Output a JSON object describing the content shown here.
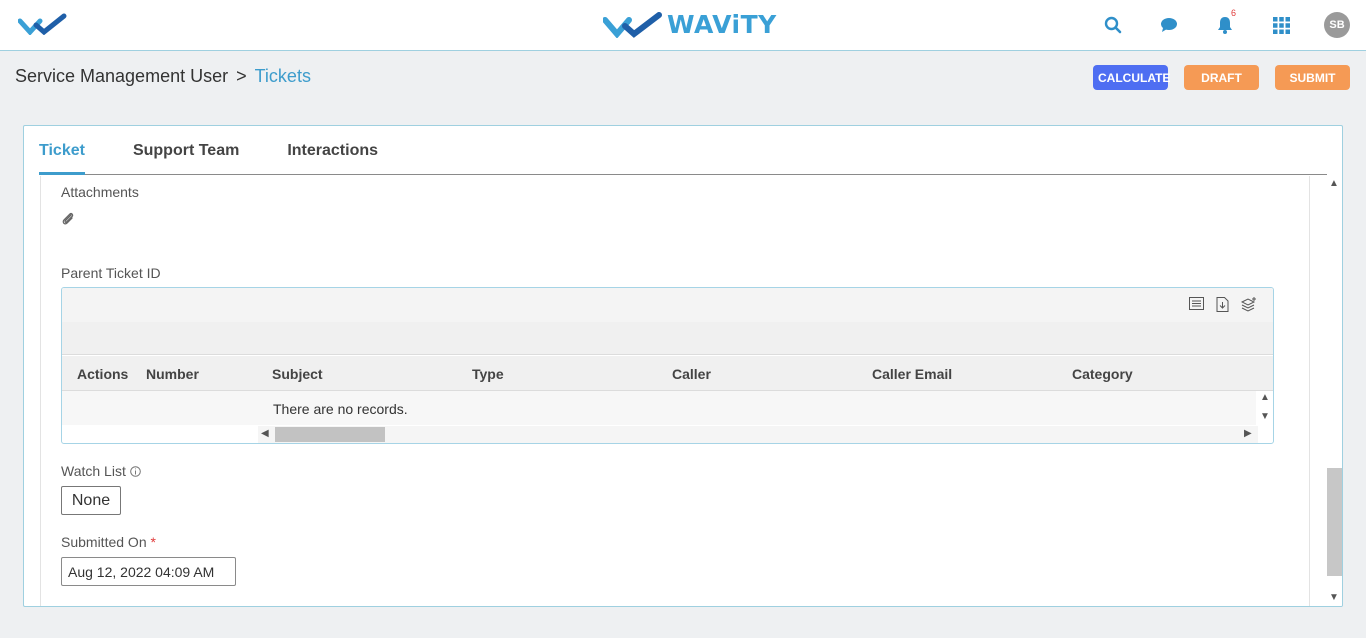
{
  "header": {
    "brand": "WAViTY",
    "notification_count": "6",
    "avatar_initials": "SB"
  },
  "breadcrumb": {
    "parent": "Service Management User",
    "separator": ">",
    "current": "Tickets"
  },
  "actions": {
    "calculate": "CALCULATE",
    "draft": "DRAFT",
    "submit": "SUBMIT"
  },
  "tabs": [
    {
      "label": "Ticket",
      "active": true
    },
    {
      "label": "Support Team",
      "active": false
    },
    {
      "label": "Interactions",
      "active": false
    }
  ],
  "form": {
    "attachments_label": "Attachments",
    "parent_ticket_label": "Parent Ticket ID",
    "grid": {
      "columns": [
        "Actions",
        "Number",
        "Subject",
        "Type",
        "Caller",
        "Caller Email",
        "Category"
      ],
      "empty_message": "There are no records."
    },
    "watch_list_label": "Watch List",
    "watch_list_value": "None",
    "submitted_on_label": "Submitted On",
    "required_mark": "*",
    "submitted_on_value": "Aug 12, 2022 04:09 AM"
  },
  "colors": {
    "accent": "#3d9ccc",
    "calculate": "#4e6ef2",
    "draft": "#f59a55",
    "required": "#e03a3a"
  }
}
